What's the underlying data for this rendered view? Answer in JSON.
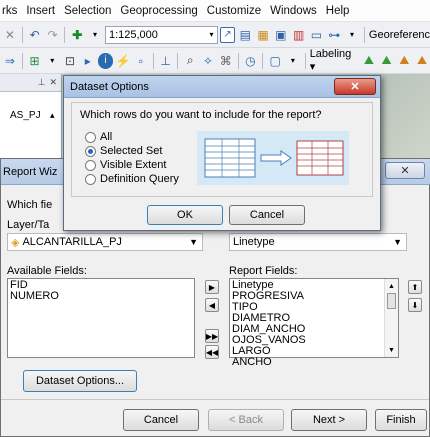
{
  "menubar": {
    "items": [
      "rks",
      "Insert",
      "Selection",
      "Geoprocessing",
      "Customize",
      "Windows",
      "Help"
    ]
  },
  "toolbar1": {
    "scale": "1:125,000",
    "georef_label": "Georeferenc"
  },
  "toolbar2": {
    "labeling_label": "Labeling ▾"
  },
  "toc": {
    "layer_fragment": "AS_PJ"
  },
  "wizard": {
    "title": "Report Wiz",
    "question": "Which fie",
    "layer_label": "Layer/Ta",
    "layer_value": "ALCANTARILLA_PJ",
    "field_value": "Linetype",
    "available_label": "Available Fields:",
    "available_fields": [
      "FID",
      "NUMERO"
    ],
    "report_label": "Report Fields:",
    "report_fields": [
      "Linetype",
      "PROGRESIVA",
      "TIPO",
      "DIAMETRO",
      "DIAM_ANCHO",
      "OJOS_VANOS",
      "LARGO",
      "ANCHO"
    ],
    "dataset_options_label": "Dataset Options...",
    "cancel_label": "Cancel",
    "back_label": "< Back",
    "next_label": "Next >",
    "finish_label": "Finish",
    "close_glyph": "✕"
  },
  "dialog": {
    "title": "Dataset Options",
    "prompt": "Which rows do you want to include for the report?",
    "options": [
      "All",
      "Selected Set",
      "Visible Extent",
      "Definition Query"
    ],
    "selected_index": 1,
    "ok_label": "OK",
    "cancel_label": "Cancel",
    "close_glyph": "✕"
  }
}
